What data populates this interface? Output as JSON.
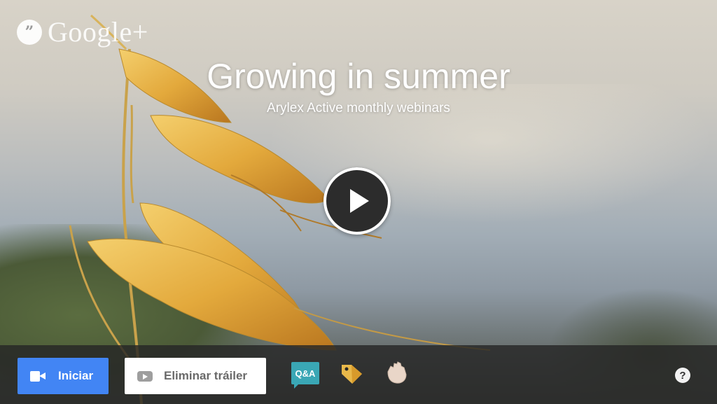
{
  "brand": {
    "name": "Google+",
    "icon": "hangouts-quote-icon",
    "glyph": "”"
  },
  "event": {
    "title": "Growing in summer",
    "subtitle": "Arylex Active monthly webinars"
  },
  "player": {
    "play_icon": "play-icon"
  },
  "toolbar": {
    "start_label": "Iniciar",
    "start_icon": "video-camera-icon",
    "remove_trailer_label": "Eliminar tráiler",
    "remove_trailer_icon": "youtube-icon",
    "apps": [
      {
        "name": "qa-app",
        "label": "Q&A",
        "color": "#3aa7b5"
      },
      {
        "name": "tag-app",
        "color": "#e8b84a"
      },
      {
        "name": "raise-hand-app",
        "color": "#e9d6c8"
      }
    ],
    "help_label": "?"
  },
  "colors": {
    "primary_button": "#4285f4",
    "toolbar_bg": "#262626"
  }
}
